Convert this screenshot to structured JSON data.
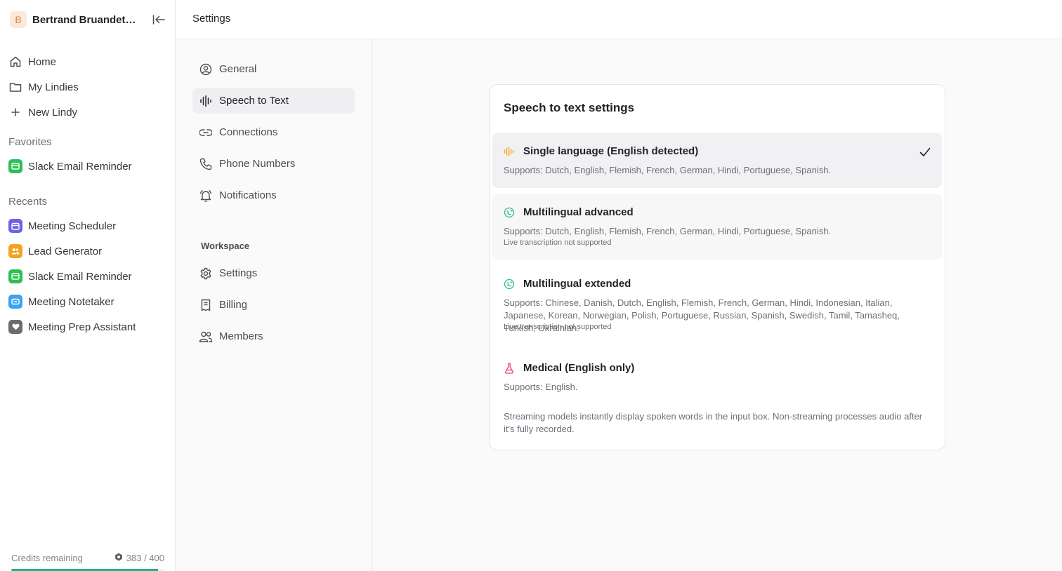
{
  "workspace": {
    "avatar_letter": "B",
    "name": "Bertrand Bruandet's..."
  },
  "sidebar": {
    "nav": [
      {
        "label": "Home",
        "icon": "home-icon"
      },
      {
        "label": "My Lindies",
        "icon": "folder-icon"
      },
      {
        "label": "New Lindy",
        "icon": "plus-icon"
      }
    ],
    "favorites_label": "Favorites",
    "favorites": [
      {
        "label": "Slack Email Reminder",
        "color": "#2fbf55"
      }
    ],
    "recents_label": "Recents",
    "recents": [
      {
        "label": "Meeting Scheduler",
        "color": "#6c63e8"
      },
      {
        "label": "Lead Generator",
        "color": "#f4a320"
      },
      {
        "label": "Slack Email Reminder",
        "color": "#2fbf55"
      },
      {
        "label": "Meeting Notetaker",
        "color": "#3aa3f2"
      },
      {
        "label": "Meeting Prep Assistant",
        "color": "#6b6b70"
      }
    ],
    "credits": {
      "label": "Credits remaining",
      "value": "383 / 400",
      "fraction": 0.9575,
      "accent": "#1fb38a"
    }
  },
  "header": {
    "title": "Settings"
  },
  "settings_nav": {
    "items": [
      {
        "label": "General",
        "icon": "user-circle-icon"
      },
      {
        "label": "Speech to Text",
        "icon": "waveform-icon",
        "active": true
      },
      {
        "label": "Connections",
        "icon": "link-icon"
      },
      {
        "label": "Phone Numbers",
        "icon": "phone-icon"
      },
      {
        "label": "Notifications",
        "icon": "bell-icon"
      }
    ],
    "workspace_label": "Workspace",
    "workspace_items": [
      {
        "label": "Settings",
        "icon": "gear-icon"
      },
      {
        "label": "Billing",
        "icon": "receipt-icon"
      },
      {
        "label": "Members",
        "icon": "users-icon"
      }
    ]
  },
  "speech": {
    "title": "Speech to text settings",
    "options": [
      {
        "title": "Single language (English detected)",
        "supports": "Supports: Dutch, English, Flemish, French, German, Hindi, Portuguese, Spanish.",
        "note": "",
        "selected": true,
        "icon_color": "#f4a320"
      },
      {
        "title": "Multilingual advanced",
        "supports": "Supports: Dutch, English, Flemish, French, German, Hindi, Portuguese, Spanish.",
        "note": "Live transcription not supported",
        "selected": false,
        "icon_color": "#2fbf8a"
      },
      {
        "title": "Multilingual extended",
        "supports": "Supports: Chinese, Danish, Dutch, English, Flemish, French, German, Hindi, Indonesian, Italian, Japanese, Korean, Norwegian, Polish, Portuguese, Russian, Spanish, Swedish, Tamil, Tamasheq, Turkish, Ukrainian.",
        "note": "Live transcription not supported",
        "selected": false,
        "icon_color": "#2fbf8a"
      },
      {
        "title": "Medical (English only)",
        "supports": "Supports: English.",
        "note": "",
        "selected": false,
        "icon_color": "#e0457b"
      }
    ],
    "footnote": "Streaming models instantly display spoken words in the input box. Non-streaming processes audio after it's fully recorded."
  }
}
